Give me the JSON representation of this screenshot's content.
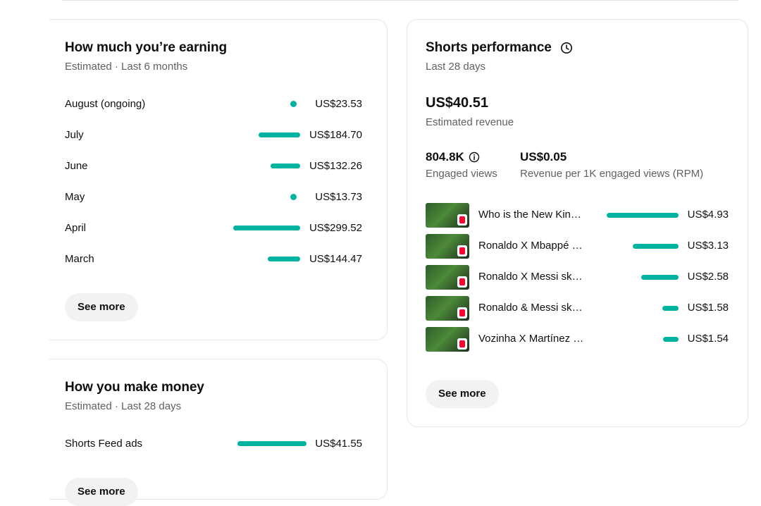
{
  "colors": {
    "accent": "#00b2a0",
    "muted_text": "#606060",
    "button_bg": "#f2f2f2"
  },
  "earning": {
    "title": "How much you’re earning",
    "subtitle": "Estimated · Last 6 months",
    "rows": [
      {
        "label": "August (ongoing)",
        "value": "US$23.53",
        "amount": 23.53
      },
      {
        "label": "July",
        "value": "US$184.70",
        "amount": 184.7
      },
      {
        "label": "June",
        "value": "US$132.26",
        "amount": 132.26
      },
      {
        "label": "May",
        "value": "US$13.73",
        "amount": 13.73
      },
      {
        "label": "April",
        "value": "US$299.52",
        "amount": 299.52
      },
      {
        "label": "March",
        "value": "US$144.47",
        "amount": 144.47
      }
    ],
    "see_more": "See more"
  },
  "money": {
    "title": "How you make money",
    "subtitle": "Estimated · Last 28 days",
    "rows": [
      {
        "label": "Shorts Feed ads",
        "value": "US$41.55",
        "amount": 41.55
      }
    ],
    "see_more": "See more"
  },
  "shorts": {
    "title": "Shorts performance",
    "title_icon": "clock-icon",
    "subtitle": "Last 28 days",
    "revenue_value": "US$40.51",
    "revenue_label": "Estimated revenue",
    "views_value": "804.8K",
    "views_label": "Engaged views",
    "views_icon": "info-icon",
    "rpm_value": "US$0.05",
    "rpm_label": "Revenue per 1K engaged views (RPM)",
    "videos": [
      {
        "title": "Who is the New King of Football?",
        "value": "US$4.93",
        "amount": 4.93
      },
      {
        "title": "Ronaldo X Mbappé skills",
        "value": "US$3.13",
        "amount": 3.13
      },
      {
        "title": "Ronaldo X Messi skills",
        "value": "US$2.58",
        "amount": 2.58
      },
      {
        "title": "Ronaldo & Messi skills",
        "value": "US$1.58",
        "amount": 1.58
      },
      {
        "title": "Vozinha X Martínez saves",
        "value": "US$1.54",
        "amount": 1.54
      }
    ],
    "see_more": "See more"
  }
}
